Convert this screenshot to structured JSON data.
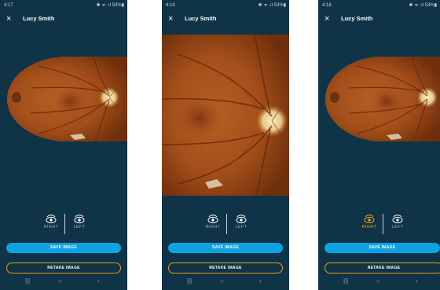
{
  "colors": {
    "background": "#0f3347",
    "accent_blue": "#0ca2e4",
    "accent_orange": "#e3a11c",
    "selected_eye": "#f0a21e"
  },
  "screens": [
    {
      "status": {
        "time": "4:17",
        "icons": "✱ ᯤ .ıl 53%▮"
      },
      "patient_name": "Lucy Smith",
      "close_icon": "×",
      "eye_right_label": "RIGHT",
      "eye_left_label": "LEFT",
      "right_eye_selected": false,
      "save_label": "SAVE IMAGE",
      "retake_label": "RETAKE IMAGE",
      "nav": {
        "recent": "|||",
        "home": "○",
        "back": "‹"
      }
    },
    {
      "status": {
        "time": "4:18",
        "icons": "✱ ᯤ .ıl 53%▮"
      },
      "patient_name": "Lucy Smith",
      "close_icon": "×",
      "eye_right_label": "RIGHT",
      "eye_left_label": "LEFT",
      "right_eye_selected": false,
      "save_label": "SAVE IMAGE",
      "retake_label": "RETAKE IMAGE",
      "nav": {
        "recent": "|||",
        "home": "○",
        "back": "‹"
      }
    },
    {
      "status": {
        "time": "4:18",
        "icons": "✱ ᯤ .ıl 53%▮"
      },
      "patient_name": "Lucy Smith",
      "close_icon": "×",
      "eye_right_label": "RIGHT",
      "eye_left_label": "LEFT",
      "right_eye_selected": true,
      "save_label": "SAVE IMAGE",
      "retake_label": "RETAKE IMAGE",
      "nav": {
        "recent": "|||",
        "home": "○",
        "back": "‹"
      }
    }
  ]
}
